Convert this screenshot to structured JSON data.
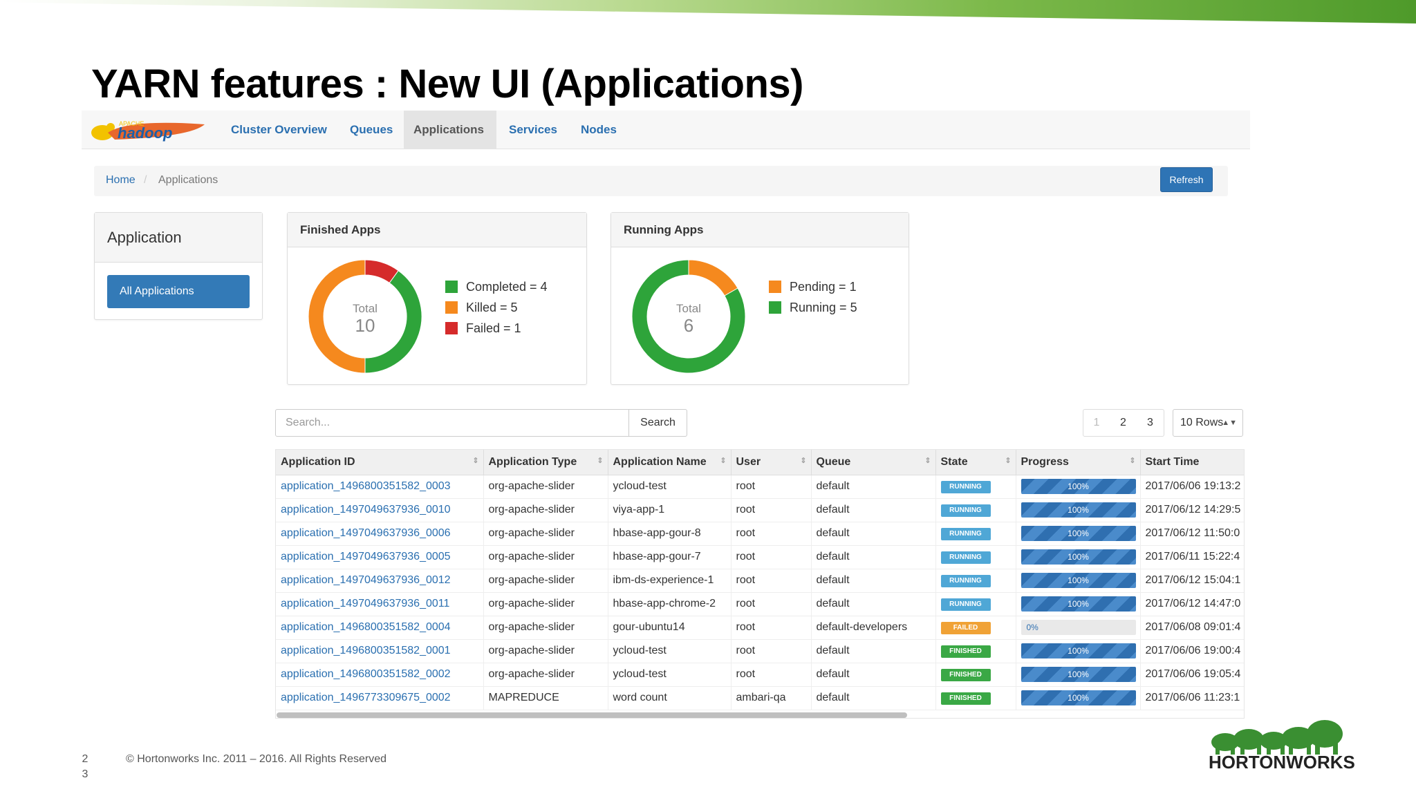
{
  "slide": {
    "title": "YARN features : New UI (Applications)",
    "footer": "© Hortonworks Inc. 2011 – 2016. All Rights Reserved",
    "page_number": "2\n3",
    "brand": "HORTONWORKS"
  },
  "nav": {
    "logo_small": "APACHE",
    "logo_text": "hadoop",
    "items": [
      "Cluster Overview",
      "Queues",
      "Applications",
      "Services",
      "Nodes"
    ],
    "active": "Applications"
  },
  "breadcrumb": {
    "home": "Home",
    "sep": "/",
    "current": "Applications",
    "refresh": "Refresh"
  },
  "sidebar": {
    "title": "Application",
    "button": "All Applications"
  },
  "finished_apps": {
    "title": "Finished Apps",
    "total_label": "Total",
    "total": "10",
    "legend": [
      {
        "label": "Completed = 4",
        "value": 4,
        "color": "#2ea43a"
      },
      {
        "label": "Killed = 5",
        "value": 5,
        "color": "#f5891e"
      },
      {
        "label": "Failed = 1",
        "value": 1,
        "color": "#d52b2b"
      }
    ]
  },
  "running_apps": {
    "title": "Running Apps",
    "total_label": "Total",
    "total": "6",
    "legend": [
      {
        "label": "Pending = 1",
        "value": 1,
        "color": "#f5891e"
      },
      {
        "label": "Running = 5",
        "value": 5,
        "color": "#2ea43a"
      }
    ]
  },
  "search": {
    "placeholder": "Search...",
    "button": "Search"
  },
  "pagination": {
    "pages": [
      "1",
      "2",
      "3"
    ],
    "rows": "10 Rows"
  },
  "table": {
    "columns": [
      "Application ID",
      "Application Type",
      "Application Name",
      "User",
      "Queue",
      "State",
      "Progress",
      "Start Time"
    ],
    "rows": [
      [
        "application_1496800351582_0003",
        "org-apache-slider",
        "ycloud-test",
        "root",
        "default",
        "RUNNING",
        "100%",
        "2017/06/06 19:13:2"
      ],
      [
        "application_1497049637936_0010",
        "org-apache-slider",
        "viya-app-1",
        "root",
        "default",
        "RUNNING",
        "100%",
        "2017/06/12 14:29:5"
      ],
      [
        "application_1497049637936_0006",
        "org-apache-slider",
        "hbase-app-gour-8",
        "root",
        "default",
        "RUNNING",
        "100%",
        "2017/06/12 11:50:0"
      ],
      [
        "application_1497049637936_0005",
        "org-apache-slider",
        "hbase-app-gour-7",
        "root",
        "default",
        "RUNNING",
        "100%",
        "2017/06/11 15:22:4"
      ],
      [
        "application_1497049637936_0012",
        "org-apache-slider",
        "ibm-ds-experience-1",
        "root",
        "default",
        "RUNNING",
        "100%",
        "2017/06/12 15:04:1"
      ],
      [
        "application_1497049637936_0011",
        "org-apache-slider",
        "hbase-app-chrome-2",
        "root",
        "default",
        "RUNNING",
        "100%",
        "2017/06/12 14:47:0"
      ],
      [
        "application_1496800351582_0004",
        "org-apache-slider",
        "gour-ubuntu14",
        "root",
        "default-developers",
        "FAILED",
        "0%",
        "2017/06/08 09:01:4"
      ],
      [
        "application_1496800351582_0001",
        "org-apache-slider",
        "ycloud-test",
        "root",
        "default",
        "FINISHED",
        "100%",
        "2017/06/06 19:00:4"
      ],
      [
        "application_1496800351582_0002",
        "org-apache-slider",
        "ycloud-test",
        "root",
        "default",
        "FINISHED",
        "100%",
        "2017/06/06 19:05:4"
      ],
      [
        "application_1496773309675_0002",
        "MAPREDUCE",
        "word count",
        "ambari-qa",
        "default",
        "FINISHED",
        "100%",
        "2017/06/06 11:23:1"
      ]
    ],
    "state_colors": {
      "RUNNING": "#4fa7d6",
      "FAILED": "#f0a236",
      "FINISHED": "#3aa845"
    }
  }
}
